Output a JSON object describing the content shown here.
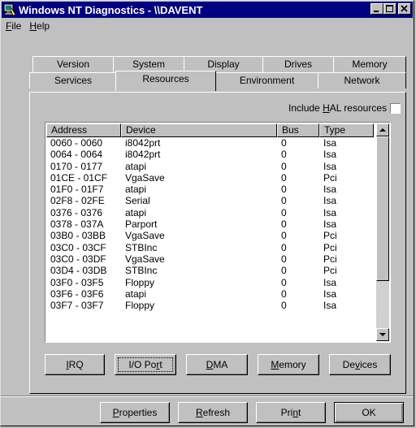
{
  "window": {
    "title": "Windows NT Diagnostics - \\\\DAVENT"
  },
  "menubar": [
    {
      "mnemonic": "F",
      "rest": "ile"
    },
    {
      "mnemonic": "H",
      "rest": "elp"
    }
  ],
  "tabs_back": [
    "Version",
    "System",
    "Display",
    "Drives",
    "Memory"
  ],
  "tabs_front": [
    "Services",
    "Resources",
    "Environment",
    "Network"
  ],
  "active_tab": "Resources",
  "hal": {
    "before": "Include ",
    "mnemonic": "H",
    "after": "AL resources"
  },
  "table": {
    "columns": [
      "Address",
      "Device",
      "Bus",
      "Type"
    ],
    "rows": [
      [
        "0060 - 0060",
        "i8042prt",
        "0",
        "Isa"
      ],
      [
        "0064 - 0064",
        "i8042prt",
        "0",
        "Isa"
      ],
      [
        "0170 - 0177",
        "atapi",
        "0",
        "Isa"
      ],
      [
        "01CE - 01CF",
        "VgaSave",
        "0",
        "Pci"
      ],
      [
        "01F0 - 01F7",
        "atapi",
        "0",
        "Isa"
      ],
      [
        "02F8 - 02FE",
        "Serial",
        "0",
        "Isa"
      ],
      [
        "0376 - 0376",
        "atapi",
        "0",
        "Isa"
      ],
      [
        "0378 - 037A",
        "Parport",
        "0",
        "Isa"
      ],
      [
        "03B0 - 03BB",
        "VgaSave",
        "0",
        "Pci"
      ],
      [
        "03C0 - 03CF",
        "STBInc",
        "0",
        "Pci"
      ],
      [
        "03C0 - 03DF",
        "VgaSave",
        "0",
        "Pci"
      ],
      [
        "03D4 - 03DB",
        "STBInc",
        "0",
        "Pci"
      ],
      [
        "03F0 - 03F5",
        "Floppy",
        "0",
        "Isa"
      ],
      [
        "03F6 - 03F6",
        "atapi",
        "0",
        "Isa"
      ],
      [
        "03F7 - 03F7",
        "Floppy",
        "0",
        "Isa"
      ]
    ]
  },
  "resource_buttons": [
    {
      "before": "",
      "mnemonic": "I",
      "after": "RQ"
    },
    {
      "before": "I/O Po",
      "mnemonic": "r",
      "after": "t"
    },
    {
      "before": "",
      "mnemonic": "D",
      "after": "MA"
    },
    {
      "before": "",
      "mnemonic": "M",
      "after": "emory"
    },
    {
      "before": "De",
      "mnemonic": "v",
      "after": "ices"
    }
  ],
  "bottom_buttons": [
    {
      "before": "",
      "mnemonic": "P",
      "after": "roperties"
    },
    {
      "before": "",
      "mnemonic": "R",
      "after": "efresh"
    },
    {
      "before": "Pri",
      "mnemonic": "n",
      "after": "t"
    },
    {
      "before": "",
      "mnemonic": "",
      "after": "OK"
    }
  ],
  "colors": {
    "titlebar": "#000080",
    "face": "#c0c0c0",
    "list_bg": "#ffffff"
  }
}
